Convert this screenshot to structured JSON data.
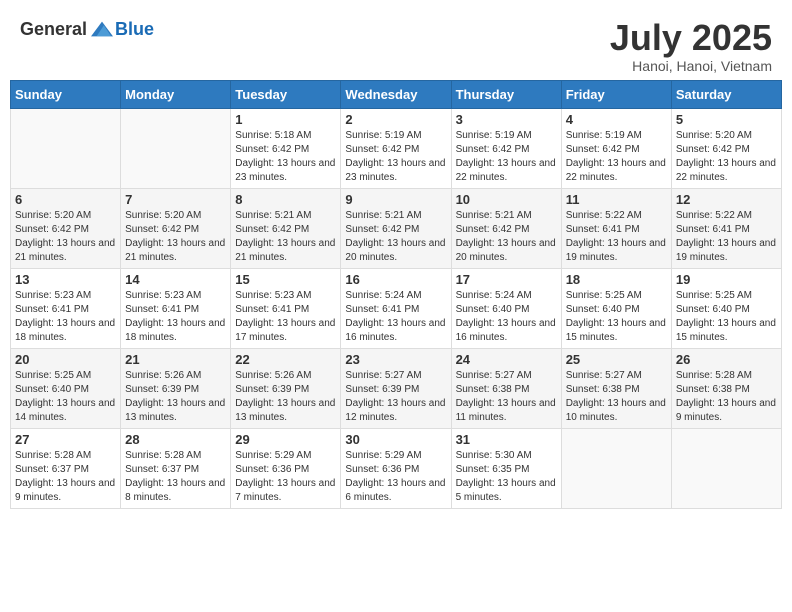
{
  "header": {
    "logo_general": "General",
    "logo_blue": "Blue",
    "month_year": "July 2025",
    "location": "Hanoi, Hanoi, Vietnam"
  },
  "weekdays": [
    "Sunday",
    "Monday",
    "Tuesday",
    "Wednesday",
    "Thursday",
    "Friday",
    "Saturday"
  ],
  "weeks": [
    [
      {
        "day": "",
        "sunrise": "",
        "sunset": "",
        "daylight": ""
      },
      {
        "day": "",
        "sunrise": "",
        "sunset": "",
        "daylight": ""
      },
      {
        "day": "1",
        "sunrise": "Sunrise: 5:18 AM",
        "sunset": "Sunset: 6:42 PM",
        "daylight": "Daylight: 13 hours and 23 minutes."
      },
      {
        "day": "2",
        "sunrise": "Sunrise: 5:19 AM",
        "sunset": "Sunset: 6:42 PM",
        "daylight": "Daylight: 13 hours and 23 minutes."
      },
      {
        "day": "3",
        "sunrise": "Sunrise: 5:19 AM",
        "sunset": "Sunset: 6:42 PM",
        "daylight": "Daylight: 13 hours and 22 minutes."
      },
      {
        "day": "4",
        "sunrise": "Sunrise: 5:19 AM",
        "sunset": "Sunset: 6:42 PM",
        "daylight": "Daylight: 13 hours and 22 minutes."
      },
      {
        "day": "5",
        "sunrise": "Sunrise: 5:20 AM",
        "sunset": "Sunset: 6:42 PM",
        "daylight": "Daylight: 13 hours and 22 minutes."
      }
    ],
    [
      {
        "day": "6",
        "sunrise": "Sunrise: 5:20 AM",
        "sunset": "Sunset: 6:42 PM",
        "daylight": "Daylight: 13 hours and 21 minutes."
      },
      {
        "day": "7",
        "sunrise": "Sunrise: 5:20 AM",
        "sunset": "Sunset: 6:42 PM",
        "daylight": "Daylight: 13 hours and 21 minutes."
      },
      {
        "day": "8",
        "sunrise": "Sunrise: 5:21 AM",
        "sunset": "Sunset: 6:42 PM",
        "daylight": "Daylight: 13 hours and 21 minutes."
      },
      {
        "day": "9",
        "sunrise": "Sunrise: 5:21 AM",
        "sunset": "Sunset: 6:42 PM",
        "daylight": "Daylight: 13 hours and 20 minutes."
      },
      {
        "day": "10",
        "sunrise": "Sunrise: 5:21 AM",
        "sunset": "Sunset: 6:42 PM",
        "daylight": "Daylight: 13 hours and 20 minutes."
      },
      {
        "day": "11",
        "sunrise": "Sunrise: 5:22 AM",
        "sunset": "Sunset: 6:41 PM",
        "daylight": "Daylight: 13 hours and 19 minutes."
      },
      {
        "day": "12",
        "sunrise": "Sunrise: 5:22 AM",
        "sunset": "Sunset: 6:41 PM",
        "daylight": "Daylight: 13 hours and 19 minutes."
      }
    ],
    [
      {
        "day": "13",
        "sunrise": "Sunrise: 5:23 AM",
        "sunset": "Sunset: 6:41 PM",
        "daylight": "Daylight: 13 hours and 18 minutes."
      },
      {
        "day": "14",
        "sunrise": "Sunrise: 5:23 AM",
        "sunset": "Sunset: 6:41 PM",
        "daylight": "Daylight: 13 hours and 18 minutes."
      },
      {
        "day": "15",
        "sunrise": "Sunrise: 5:23 AM",
        "sunset": "Sunset: 6:41 PM",
        "daylight": "Daylight: 13 hours and 17 minutes."
      },
      {
        "day": "16",
        "sunrise": "Sunrise: 5:24 AM",
        "sunset": "Sunset: 6:41 PM",
        "daylight": "Daylight: 13 hours and 16 minutes."
      },
      {
        "day": "17",
        "sunrise": "Sunrise: 5:24 AM",
        "sunset": "Sunset: 6:40 PM",
        "daylight": "Daylight: 13 hours and 16 minutes."
      },
      {
        "day": "18",
        "sunrise": "Sunrise: 5:25 AM",
        "sunset": "Sunset: 6:40 PM",
        "daylight": "Daylight: 13 hours and 15 minutes."
      },
      {
        "day": "19",
        "sunrise": "Sunrise: 5:25 AM",
        "sunset": "Sunset: 6:40 PM",
        "daylight": "Daylight: 13 hours and 15 minutes."
      }
    ],
    [
      {
        "day": "20",
        "sunrise": "Sunrise: 5:25 AM",
        "sunset": "Sunset: 6:40 PM",
        "daylight": "Daylight: 13 hours and 14 minutes."
      },
      {
        "day": "21",
        "sunrise": "Sunrise: 5:26 AM",
        "sunset": "Sunset: 6:39 PM",
        "daylight": "Daylight: 13 hours and 13 minutes."
      },
      {
        "day": "22",
        "sunrise": "Sunrise: 5:26 AM",
        "sunset": "Sunset: 6:39 PM",
        "daylight": "Daylight: 13 hours and 13 minutes."
      },
      {
        "day": "23",
        "sunrise": "Sunrise: 5:27 AM",
        "sunset": "Sunset: 6:39 PM",
        "daylight": "Daylight: 13 hours and 12 minutes."
      },
      {
        "day": "24",
        "sunrise": "Sunrise: 5:27 AM",
        "sunset": "Sunset: 6:38 PM",
        "daylight": "Daylight: 13 hours and 11 minutes."
      },
      {
        "day": "25",
        "sunrise": "Sunrise: 5:27 AM",
        "sunset": "Sunset: 6:38 PM",
        "daylight": "Daylight: 13 hours and 10 minutes."
      },
      {
        "day": "26",
        "sunrise": "Sunrise: 5:28 AM",
        "sunset": "Sunset: 6:38 PM",
        "daylight": "Daylight: 13 hours and 9 minutes."
      }
    ],
    [
      {
        "day": "27",
        "sunrise": "Sunrise: 5:28 AM",
        "sunset": "Sunset: 6:37 PM",
        "daylight": "Daylight: 13 hours and 9 minutes."
      },
      {
        "day": "28",
        "sunrise": "Sunrise: 5:28 AM",
        "sunset": "Sunset: 6:37 PM",
        "daylight": "Daylight: 13 hours and 8 minutes."
      },
      {
        "day": "29",
        "sunrise": "Sunrise: 5:29 AM",
        "sunset": "Sunset: 6:36 PM",
        "daylight": "Daylight: 13 hours and 7 minutes."
      },
      {
        "day": "30",
        "sunrise": "Sunrise: 5:29 AM",
        "sunset": "Sunset: 6:36 PM",
        "daylight": "Daylight: 13 hours and 6 minutes."
      },
      {
        "day": "31",
        "sunrise": "Sunrise: 5:30 AM",
        "sunset": "Sunset: 6:35 PM",
        "daylight": "Daylight: 13 hours and 5 minutes."
      },
      {
        "day": "",
        "sunrise": "",
        "sunset": "",
        "daylight": ""
      },
      {
        "day": "",
        "sunrise": "",
        "sunset": "",
        "daylight": ""
      }
    ]
  ]
}
